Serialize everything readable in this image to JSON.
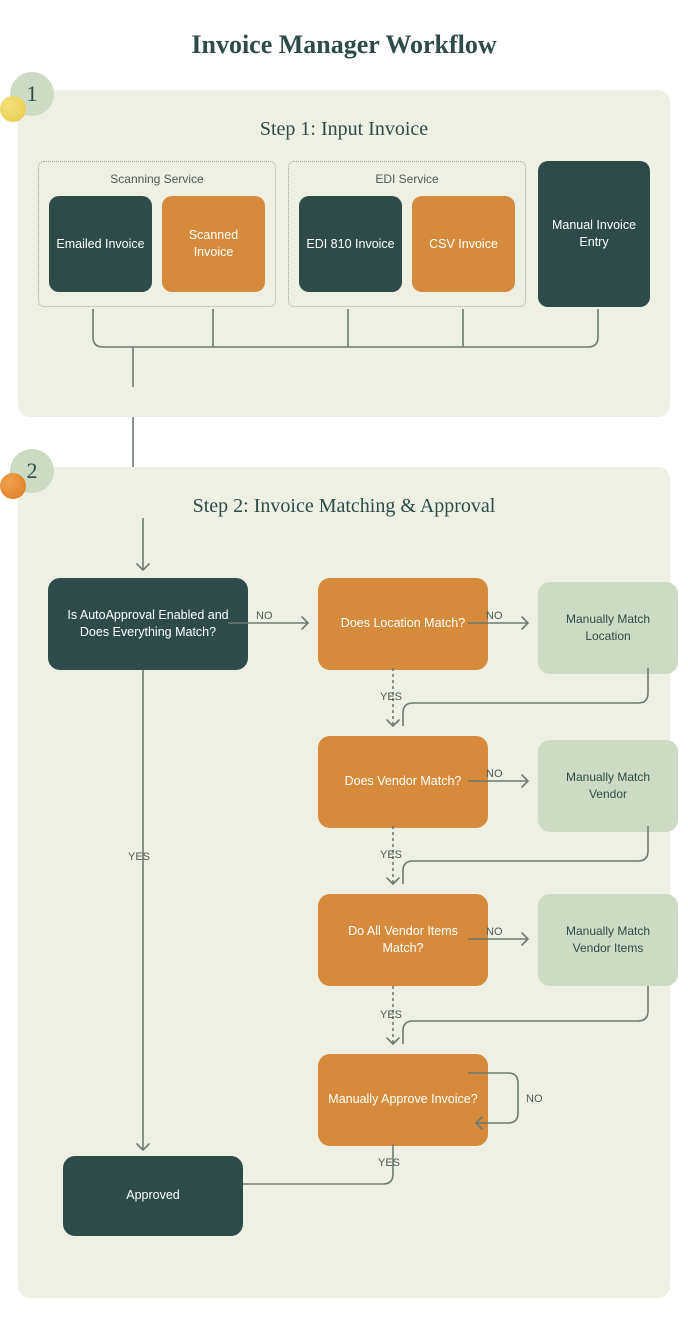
{
  "title": "Invoice Manager Workflow",
  "step1": {
    "badge_num": "1",
    "heading": "Step 1: Input Invoice",
    "scanning_label": "Scanning Service",
    "edi_label": "EDI Service",
    "nodes": {
      "emailed": "Emailed Invoice",
      "scanned": "Scanned Invoice",
      "edi810": "EDI 810 Invoice",
      "csv": "CSV Invoice",
      "manual": "Manual Invoice Entry"
    }
  },
  "gap_label_placeholder": "",
  "step2": {
    "badge_num": "2",
    "heading": "Step 2: Invoice Matching & Approval",
    "nodes": {
      "autoapproval": "Is AutoApproval Enabled and\nDoes Everything Match?",
      "loc_q": "Does Location Match?",
      "loc_manual": "Manually Match Location",
      "vendor_q": "Does Vendor Match?",
      "vendor_manual": "Manually Match Vendor",
      "items_q": "Do All Vendor Items Match?",
      "items_manual": "Manually Match Vendor Items",
      "approve_q": "Manually Approve Invoice?",
      "approved": "Approved"
    },
    "labels": {
      "yes": "YES",
      "no": "NO"
    }
  }
}
